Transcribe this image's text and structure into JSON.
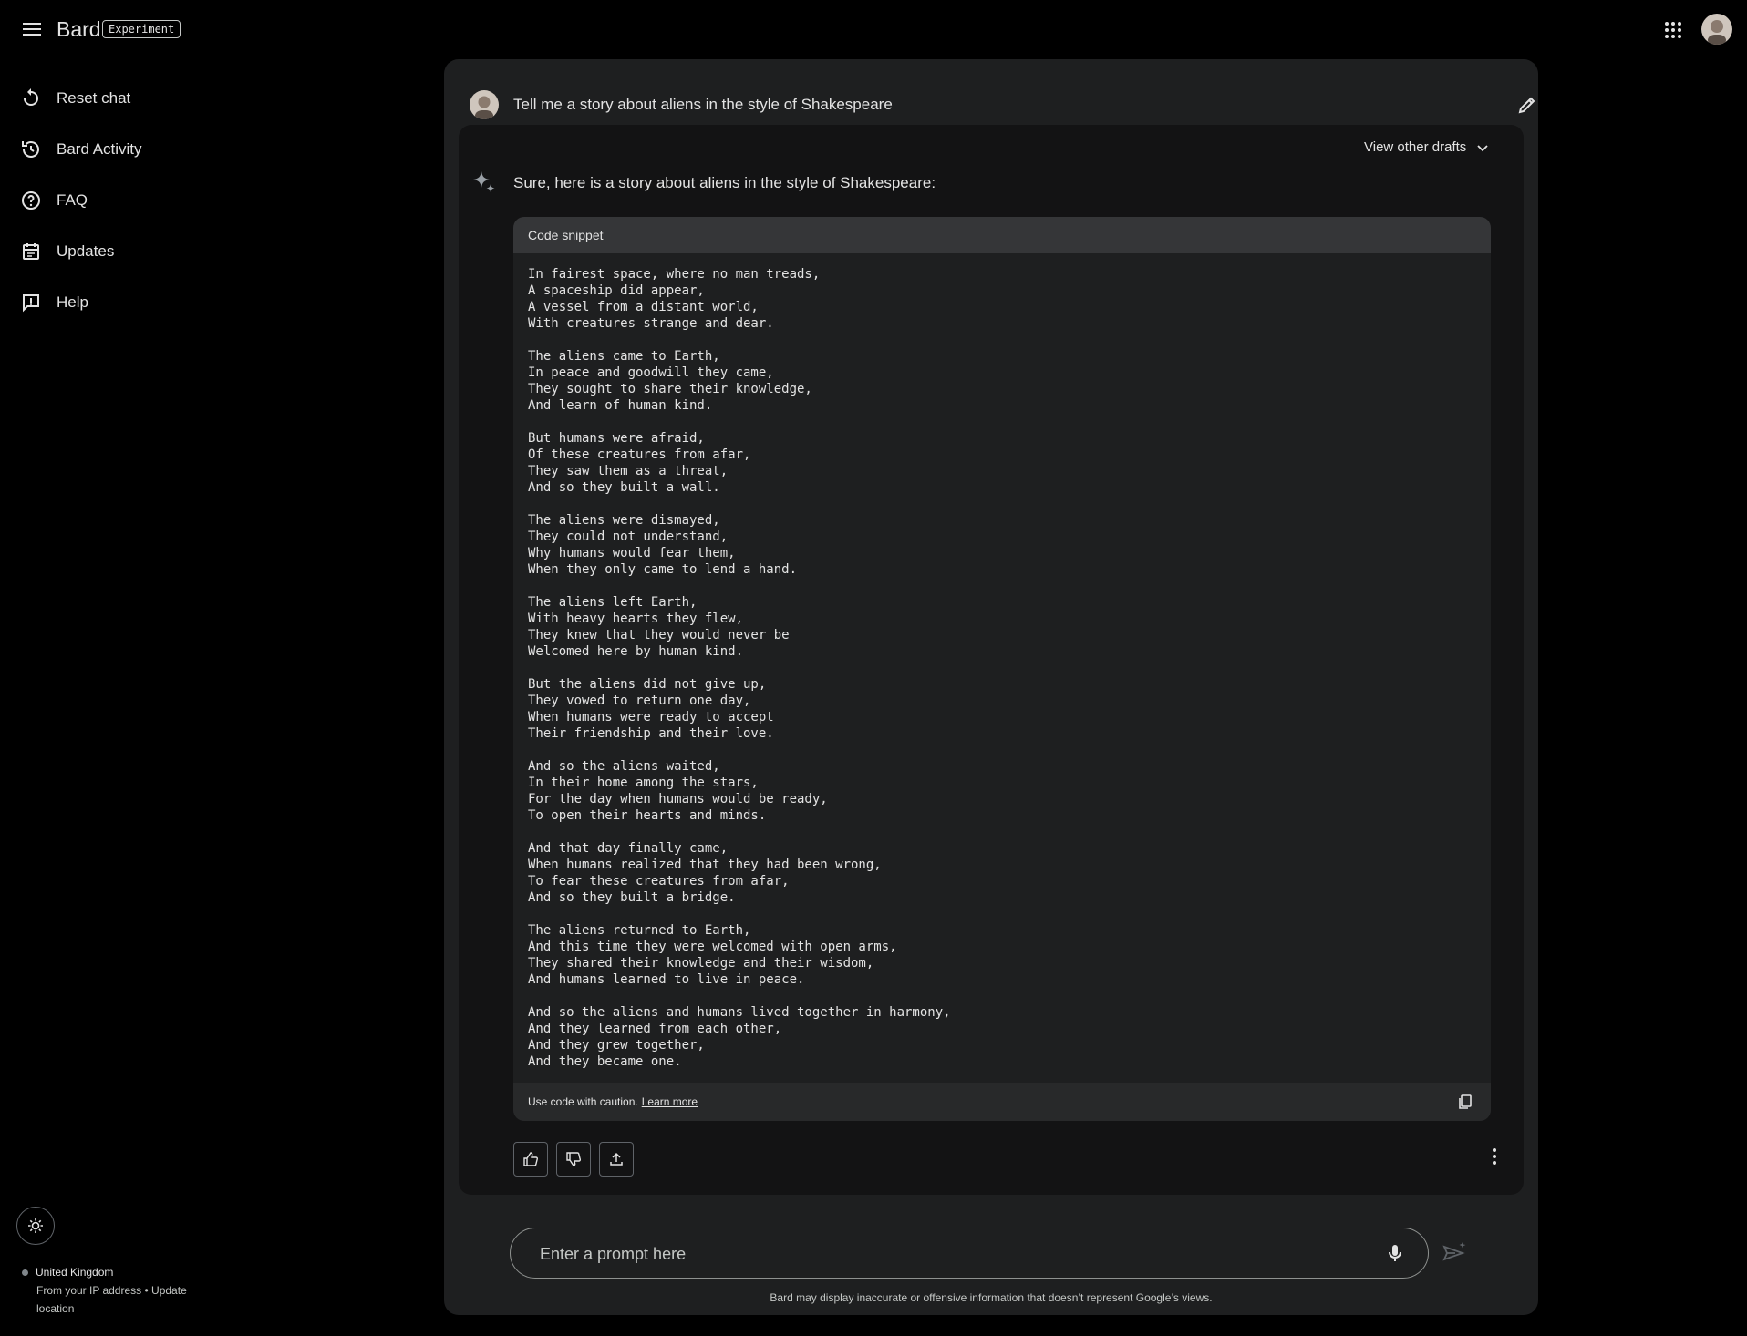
{
  "app": {
    "name": "Bard",
    "badge": "Experiment"
  },
  "sidebar": {
    "items": [
      {
        "label": "Reset chat",
        "icon": "reset-icon"
      },
      {
        "label": "Bard Activity",
        "icon": "history-icon"
      },
      {
        "label": "FAQ",
        "icon": "help-circle-icon"
      },
      {
        "label": "Updates",
        "icon": "calendar-icon"
      },
      {
        "label": "Help",
        "icon": "feedback-icon"
      }
    ]
  },
  "location": {
    "country": "United Kingdom",
    "source": "From your IP address",
    "separator": "•",
    "update_link": "Update location"
  },
  "conversation": {
    "prompt": "Tell me a story about aliens in the style of Shakespeare",
    "view_drafts": "View other drafts",
    "response_intro": "Sure, here is a story about aliens in the style of Shakespeare:",
    "code_block": {
      "header": "Code snippet",
      "content": "In fairest space, where no man treads,\nA spaceship did appear,\nA vessel from a distant world,\nWith creatures strange and dear.\n\nThe aliens came to Earth,\nIn peace and goodwill they came,\nThey sought to share their knowledge,\nAnd learn of human kind.\n\nBut humans were afraid,\nOf these creatures from afar,\nThey saw them as a threat,\nAnd so they built a wall.\n\nThe aliens were dismayed,\nThey could not understand,\nWhy humans would fear them,\nWhen they only came to lend a hand.\n\nThe aliens left Earth,\nWith heavy hearts they flew,\nThey knew that they would never be\nWelcomed here by human kind.\n\nBut the aliens did not give up,\nThey vowed to return one day,\nWhen humans were ready to accept\nTheir friendship and their love.\n\nAnd so the aliens waited,\nIn their home among the stars,\nFor the day when humans would be ready,\nTo open their hearts and minds.\n\nAnd that day finally came,\nWhen humans realized that they had been wrong,\nTo fear these creatures from afar,\nAnd so they built a bridge.\n\nThe aliens returned to Earth,\nAnd this time they were welcomed with open arms,\nThey shared their knowledge and their wisdom,\nAnd humans learned to live in peace.\n\nAnd so the aliens and humans lived together in harmony,\nAnd they learned from each other,\nAnd they grew together,\nAnd they became one.",
      "caution": "Use code with caution.",
      "learn_more": "Learn more"
    }
  },
  "input": {
    "placeholder": "Enter a prompt here"
  },
  "disclaimer": "Bard may display inaccurate or offensive information that doesn’t represent Google’s views."
}
